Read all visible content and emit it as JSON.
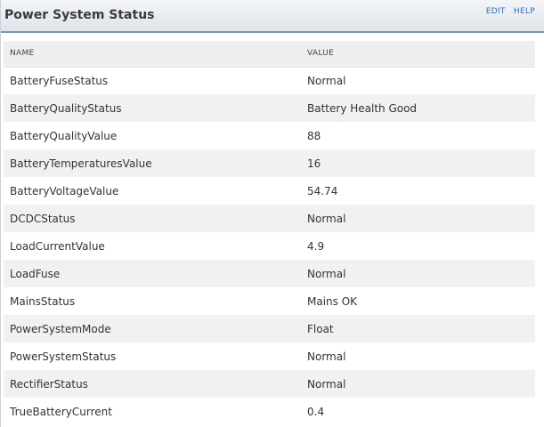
{
  "header": {
    "title": "Power System Status",
    "edit_label": "EDIT",
    "help_label": "HELP"
  },
  "table": {
    "columns": [
      "NAME",
      "VALUE"
    ],
    "rows": [
      {
        "name": "BatteryFuseStatus",
        "value": "Normal"
      },
      {
        "name": "BatteryQualityStatus",
        "value": "Battery Health Good"
      },
      {
        "name": "BatteryQualityValue",
        "value": "88"
      },
      {
        "name": "BatteryTemperaturesValue",
        "value": "16"
      },
      {
        "name": "BatteryVoltageValue",
        "value": "54.74"
      },
      {
        "name": "DCDCStatus",
        "value": "Normal"
      },
      {
        "name": "LoadCurrentValue",
        "value": "4.9"
      },
      {
        "name": "LoadFuse",
        "value": "Normal"
      },
      {
        "name": "MainsStatus",
        "value": "Mains OK"
      },
      {
        "name": "PowerSystemMode",
        "value": "Float"
      },
      {
        "name": "PowerSystemStatus",
        "value": "Normal"
      },
      {
        "name": "RectifierStatus",
        "value": "Normal"
      },
      {
        "name": "TrueBatteryCurrent",
        "value": "0.4"
      }
    ]
  }
}
